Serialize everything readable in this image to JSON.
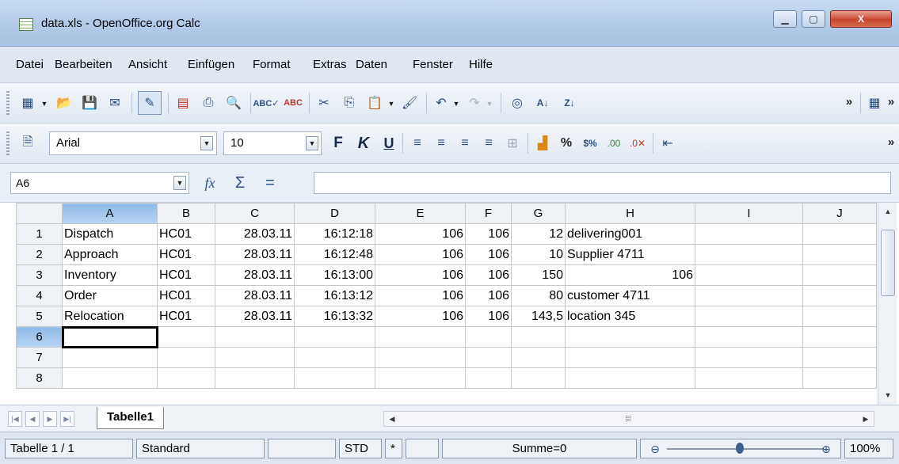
{
  "window": {
    "title": "data.xls - OpenOffice.org Calc",
    "controls": {
      "minimize": "▁",
      "maximize": "▢",
      "close": "X"
    }
  },
  "menu": [
    "Datei",
    "Bearbeiten",
    "Ansicht",
    "Einfügen",
    "Format",
    "Extras",
    "Daten",
    "Fenster",
    "Hilfe"
  ],
  "format_toolbar": {
    "font_name": "Arial",
    "font_size": "10",
    "bold_label": "F",
    "italic_label": "K",
    "underline_label": "U",
    "percent_label": "%"
  },
  "formula_bar": {
    "cell_reference": "A6",
    "function_wizard_label": "fx",
    "sum_label": "Σ",
    "equals_label": "=",
    "formula_value": ""
  },
  "grid": {
    "columns": [
      "A",
      "B",
      "C",
      "D",
      "E",
      "F",
      "G",
      "H",
      "I",
      "J"
    ],
    "rows": [
      {
        "num": "1",
        "cells": [
          "Dispatch",
          "HC01",
          "28.03.11",
          "16:12:18",
          "106",
          "106",
          "12",
          "delivering001",
          "",
          ""
        ]
      },
      {
        "num": "2",
        "cells": [
          "Approach",
          "HC01",
          "28.03.11",
          "16:12:48",
          "106",
          "106",
          "10",
          "Supplier 4711",
          "",
          ""
        ]
      },
      {
        "num": "3",
        "cells": [
          "Inventory",
          "HC01",
          "28.03.11",
          "16:13:00",
          "106",
          "106",
          "150",
          "106",
          "",
          ""
        ]
      },
      {
        "num": "4",
        "cells": [
          "Order",
          "HC01",
          "28.03.11",
          "16:13:12",
          "106",
          "106",
          "80",
          "customer 4711",
          "",
          ""
        ]
      },
      {
        "num": "5",
        "cells": [
          "Relocation",
          "HC01",
          "28.03.11",
          "16:13:32",
          "106",
          "106",
          "143,5",
          "location 345",
          "",
          ""
        ]
      },
      {
        "num": "6",
        "cells": [
          "",
          "",
          "",
          "",
          "",
          "",
          "",
          "",
          "",
          ""
        ]
      },
      {
        "num": "7",
        "cells": [
          "",
          "",
          "",
          "",
          "",
          "",
          "",
          "",
          "",
          ""
        ]
      },
      {
        "num": "8",
        "cells": [
          "",
          "",
          "",
          "",
          "",
          "",
          "",
          "",
          "",
          ""
        ]
      }
    ],
    "selected_cell": "A6"
  },
  "sheet_tabs": {
    "active": "Tabelle1"
  },
  "status_bar": {
    "sheet_indicator": "Tabelle 1 / 1",
    "page_style": "Standard",
    "selection_mode": "STD",
    "modified_indicator": "*",
    "sum": "Summe=0",
    "zoom": "100%"
  }
}
